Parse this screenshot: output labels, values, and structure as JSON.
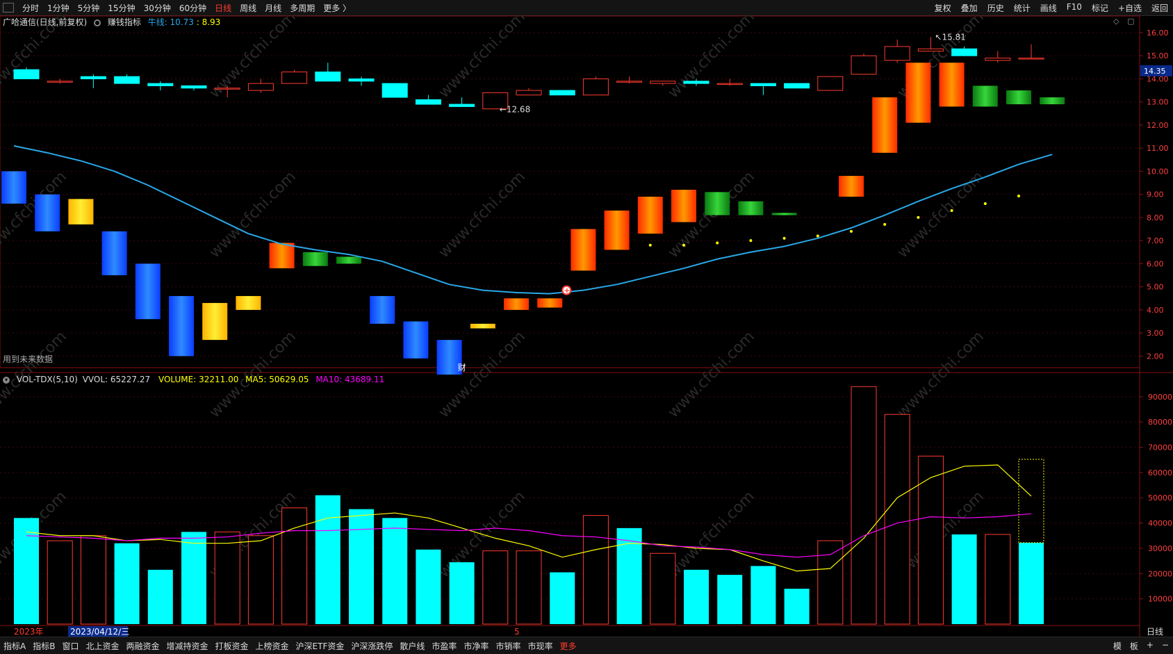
{
  "topbar": {
    "periods": [
      {
        "label": "分时",
        "active": false
      },
      {
        "label": "1分钟",
        "active": false
      },
      {
        "label": "5分钟",
        "active": false
      },
      {
        "label": "15分钟",
        "active": false
      },
      {
        "label": "30分钟",
        "active": false
      },
      {
        "label": "60分钟",
        "active": false
      },
      {
        "label": "日线",
        "active": true
      },
      {
        "label": "周线",
        "active": false
      },
      {
        "label": "月线",
        "active": false
      },
      {
        "label": "多周期",
        "active": false
      },
      {
        "label": "更多 〉",
        "active": false
      }
    ],
    "tools": [
      "复权",
      "叠加",
      "历史",
      "统计",
      "画线",
      "F10",
      "标记",
      "+自选",
      "返回"
    ]
  },
  "price_legend": {
    "stock": "广哈通信(日线,前复权)",
    "indicator": "赚钱指标",
    "line_label": "牛线: 10.73",
    "line_value2": ": 8.93"
  },
  "volume_legend": {
    "name": "VOL-TDX(5,10)",
    "vvol": "VVOL: 65227.27",
    "volume": "VOLUME: 32211.00",
    "ma5": "MA5: 50629.05",
    "ma10": "MA10: 43689.11"
  },
  "labels": {
    "future_data": "用到未来数据",
    "cai_marker": "财",
    "year": "2023年",
    "date_cursor": "2023/04/12/三",
    "month_mark": "5",
    "period_corner": "日线"
  },
  "bottombar": {
    "tabs": [
      {
        "label": "指标A",
        "active": false
      },
      {
        "label": "指标B",
        "active": false
      },
      {
        "label": "窗口",
        "active": false
      },
      {
        "label": "北上资金",
        "active": false
      },
      {
        "label": "两融资金",
        "active": false
      },
      {
        "label": "增减持资金",
        "active": false
      },
      {
        "label": "打板资金",
        "active": false
      },
      {
        "label": "上榜资金",
        "active": false
      },
      {
        "label": "沪深ETF资金",
        "active": false
      },
      {
        "label": "沪深涨跌停",
        "active": false
      },
      {
        "label": "散户线",
        "active": false
      },
      {
        "label": "市盈率",
        "active": false
      },
      {
        "label": "市净率",
        "active": false
      },
      {
        "label": "市销率",
        "active": false
      },
      {
        "label": "市现率",
        "active": false
      },
      {
        "label": "更多",
        "active": true
      }
    ],
    "right": [
      "模",
      "板",
      "+",
      "−"
    ]
  },
  "colors": {
    "up": "#ff3b30",
    "down": "#00ffff",
    "ma5": "#ffff00",
    "ma10": "#ff00ff",
    "bull_line": "#29a8e8",
    "watermark": "www.cfchi.com"
  },
  "chart_data": [
    {
      "type": "candlestick",
      "title": "广哈通信(日线,前复权)",
      "ylim": [
        1.5,
        16.3
      ],
      "yticks": [
        "16.00",
        "15.00",
        "14.00",
        "13.00",
        "12.00",
        "11.00",
        "10.00",
        "9.00",
        "8.00",
        "7.00",
        "6.00",
        "5.00",
        "4.00",
        "3.00",
        "2.00"
      ],
      "current_price": "14.35",
      "annotations": {
        "high": "15.81",
        "low": "12.68"
      },
      "candles": [
        {
          "o": 14.4,
          "c": 14.0,
          "h": 14.5,
          "l": 14.0
        },
        {
          "o": 13.9,
          "c": 13.9,
          "h": 14.0,
          "l": 13.8
        },
        {
          "o": 14.1,
          "c": 14.0,
          "h": 14.2,
          "l": 13.6
        },
        {
          "o": 14.1,
          "c": 13.8,
          "h": 14.2,
          "l": 13.8
        },
        {
          "o": 13.8,
          "c": 13.7,
          "h": 13.9,
          "l": 13.5
        },
        {
          "o": 13.7,
          "c": 13.6,
          "h": 13.7,
          "l": 13.5
        },
        {
          "o": 13.6,
          "c": 13.6,
          "h": 13.7,
          "l": 13.2
        },
        {
          "o": 13.5,
          "c": 13.8,
          "h": 14.0,
          "l": 13.4
        },
        {
          "o": 13.8,
          "c": 14.3,
          "h": 14.4,
          "l": 13.8
        },
        {
          "o": 14.3,
          "c": 13.9,
          "h": 14.7,
          "l": 13.9
        },
        {
          "o": 14.0,
          "c": 13.9,
          "h": 14.1,
          "l": 13.7
        },
        {
          "o": 13.8,
          "c": 13.2,
          "h": 13.8,
          "l": 13.2
        },
        {
          "o": 13.1,
          "c": 12.9,
          "h": 13.3,
          "l": 12.9
        },
        {
          "o": 12.9,
          "c": 12.8,
          "h": 13.2,
          "l": 12.8
        },
        {
          "o": 12.7,
          "c": 13.4,
          "h": 13.4,
          "l": 12.7
        },
        {
          "o": 13.3,
          "c": 13.5,
          "h": 13.6,
          "l": 13.3
        },
        {
          "o": 13.5,
          "c": 13.3,
          "h": 13.5,
          "l": 13.3
        },
        {
          "o": 13.3,
          "c": 14.0,
          "h": 14.1,
          "l": 13.3
        },
        {
          "o": 13.9,
          "c": 13.9,
          "h": 14.1,
          "l": 13.8
        },
        {
          "o": 13.8,
          "c": 13.9,
          "h": 13.9,
          "l": 13.7
        },
        {
          "o": 13.9,
          "c": 13.8,
          "h": 14.0,
          "l": 13.7
        },
        {
          "o": 13.8,
          "c": 13.8,
          "h": 14.0,
          "l": 13.7
        },
        {
          "o": 13.8,
          "c": 13.7,
          "h": 13.8,
          "l": 13.3
        },
        {
          "o": 13.8,
          "c": 13.6,
          "h": 13.8,
          "l": 13.6
        },
        {
          "o": 13.5,
          "c": 14.1,
          "h": 14.1,
          "l": 13.5
        },
        {
          "o": 14.2,
          "c": 15.0,
          "h": 15.1,
          "l": 14.2
        },
        {
          "o": 14.8,
          "c": 15.4,
          "h": 15.7,
          "l": 14.7
        },
        {
          "o": 15.2,
          "c": 15.3,
          "h": 15.81,
          "l": 15.2
        },
        {
          "o": 15.3,
          "c": 15.0,
          "h": 15.4,
          "l": 15.0
        },
        {
          "o": 14.8,
          "c": 14.9,
          "h": 15.2,
          "l": 14.7
        },
        {
          "o": 14.9,
          "c": 14.9,
          "h": 15.5,
          "l": 14.9
        }
      ],
      "indicator_blocks": [
        {
          "top": 10.0,
          "bottom": 8.6,
          "color": "blue"
        },
        {
          "top": 9.0,
          "bottom": 7.4,
          "color": "blue"
        },
        {
          "top": 8.8,
          "bottom": 7.7,
          "color": "yellow"
        },
        {
          "top": 7.4,
          "bottom": 5.5,
          "color": "blue"
        },
        {
          "top": 6.0,
          "bottom": 3.6,
          "color": "blue"
        },
        {
          "top": 4.6,
          "bottom": 2.0,
          "color": "blue"
        },
        {
          "top": 4.3,
          "bottom": 2.7,
          "color": "yellow"
        },
        {
          "top": 4.6,
          "bottom": 4.0,
          "color": "yellow"
        },
        {
          "top": 6.9,
          "bottom": 5.8,
          "color": "red"
        },
        {
          "top": 6.5,
          "bottom": 5.9,
          "color": "green"
        },
        {
          "top": 6.3,
          "bottom": 6.0,
          "color": "green"
        },
        {
          "top": 4.6,
          "bottom": 3.4,
          "color": "blue"
        },
        {
          "top": 3.5,
          "bottom": 1.9,
          "color": "blue"
        },
        {
          "top": 2.7,
          "bottom": 1.2,
          "color": "blue"
        },
        {
          "top": 3.4,
          "bottom": 3.2,
          "color": "yellow"
        },
        {
          "top": 4.5,
          "bottom": 4.0,
          "color": "red"
        },
        {
          "top": 4.5,
          "bottom": 4.1,
          "color": "red"
        },
        {
          "top": 7.5,
          "bottom": 5.7,
          "color": "red"
        },
        {
          "top": 8.3,
          "bottom": 6.6,
          "color": "red"
        },
        {
          "top": 8.9,
          "bottom": 7.3,
          "color": "red"
        },
        {
          "top": 9.2,
          "bottom": 7.8,
          "color": "red"
        },
        {
          "top": 9.1,
          "bottom": 8.1,
          "color": "green"
        },
        {
          "top": 8.7,
          "bottom": 8.1,
          "color": "green"
        },
        {
          "top": 8.2,
          "bottom": 8.1,
          "color": "green"
        },
        null,
        {
          "top": 9.8,
          "bottom": 8.9,
          "color": "red"
        },
        {
          "top": 13.2,
          "bottom": 10.8,
          "color": "red"
        },
        {
          "top": 14.7,
          "bottom": 12.1,
          "color": "red"
        },
        {
          "top": 14.7,
          "bottom": 12.8,
          "color": "red"
        },
        {
          "top": 13.7,
          "bottom": 12.8,
          "color": "green"
        },
        {
          "top": 13.5,
          "bottom": 12.9,
          "color": "green"
        },
        {
          "top": 13.2,
          "bottom": 12.9,
          "color": "green"
        }
      ],
      "bull_line": [
        11.1,
        10.8,
        10.45,
        10.0,
        9.4,
        8.7,
        8.0,
        7.3,
        6.85,
        6.6,
        6.4,
        6.1,
        5.6,
        5.1,
        4.85,
        4.75,
        4.7,
        4.85,
        5.1,
        5.45,
        5.8,
        6.2,
        6.5,
        6.75,
        7.1,
        7.55,
        8.1,
        8.7,
        9.25,
        9.75,
        10.3,
        10.73
      ],
      "dots": [
        {
          "i": 19,
          "v": 6.8
        },
        {
          "i": 20,
          "v": 6.8
        },
        {
          "i": 21,
          "v": 6.9
        },
        {
          "i": 22,
          "v": 7.0
        },
        {
          "i": 23,
          "v": 7.1
        },
        {
          "i": 24,
          "v": 7.2
        },
        {
          "i": 25,
          "v": 7.4
        },
        {
          "i": 26,
          "v": 7.7
        },
        {
          "i": 27,
          "v": 8.0
        },
        {
          "i": 28,
          "v": 8.3
        },
        {
          "i": 29,
          "v": 8.6
        },
        {
          "i": 30,
          "v": 8.93
        }
      ]
    },
    {
      "type": "bar",
      "title": "VOL-TDX(5,10)",
      "ylim": [
        0,
        96000
      ],
      "yticks": [
        "90000",
        "80000",
        "70000",
        "60000",
        "50000",
        "40000",
        "30000",
        "20000",
        "10000"
      ],
      "values": [
        42000,
        33000,
        35000,
        32000,
        21500,
        36500,
        36500,
        35000,
        46000,
        51000,
        45500,
        42000,
        29500,
        24500,
        29000,
        29000,
        20500,
        43000,
        38000,
        28000,
        21500,
        19500,
        23000,
        14000,
        33000,
        94000,
        83000,
        66500,
        35500,
        35500,
        32211
      ],
      "up": [
        false,
        true,
        true,
        false,
        false,
        false,
        true,
        true,
        true,
        false,
        false,
        false,
        false,
        false,
        true,
        true,
        false,
        true,
        false,
        true,
        false,
        false,
        false,
        false,
        true,
        true,
        true,
        true,
        false,
        true,
        false
      ],
      "current_dashed": 65227.27,
      "ma5": [
        36500,
        35000,
        35000,
        33000,
        33500,
        32000,
        32000,
        33000,
        38000,
        42000,
        43000,
        44000,
        42000,
        38000,
        34000,
        31000,
        26500,
        29500,
        32000,
        31500,
        30000,
        29500,
        25000,
        21000,
        22000,
        34000,
        50000,
        58000,
        62500,
        63000,
        50629
      ],
      "ma10": [
        35000,
        34500,
        34000,
        33000,
        34000,
        34000,
        34500,
        36000,
        37000,
        37000,
        37500,
        38000,
        37500,
        37000,
        38000,
        37000,
        35000,
        34500,
        33000,
        31000,
        30500,
        29500,
        27500,
        26500,
        27500,
        35000,
        40000,
        42500,
        42000,
        42500,
        43689
      ]
    }
  ]
}
